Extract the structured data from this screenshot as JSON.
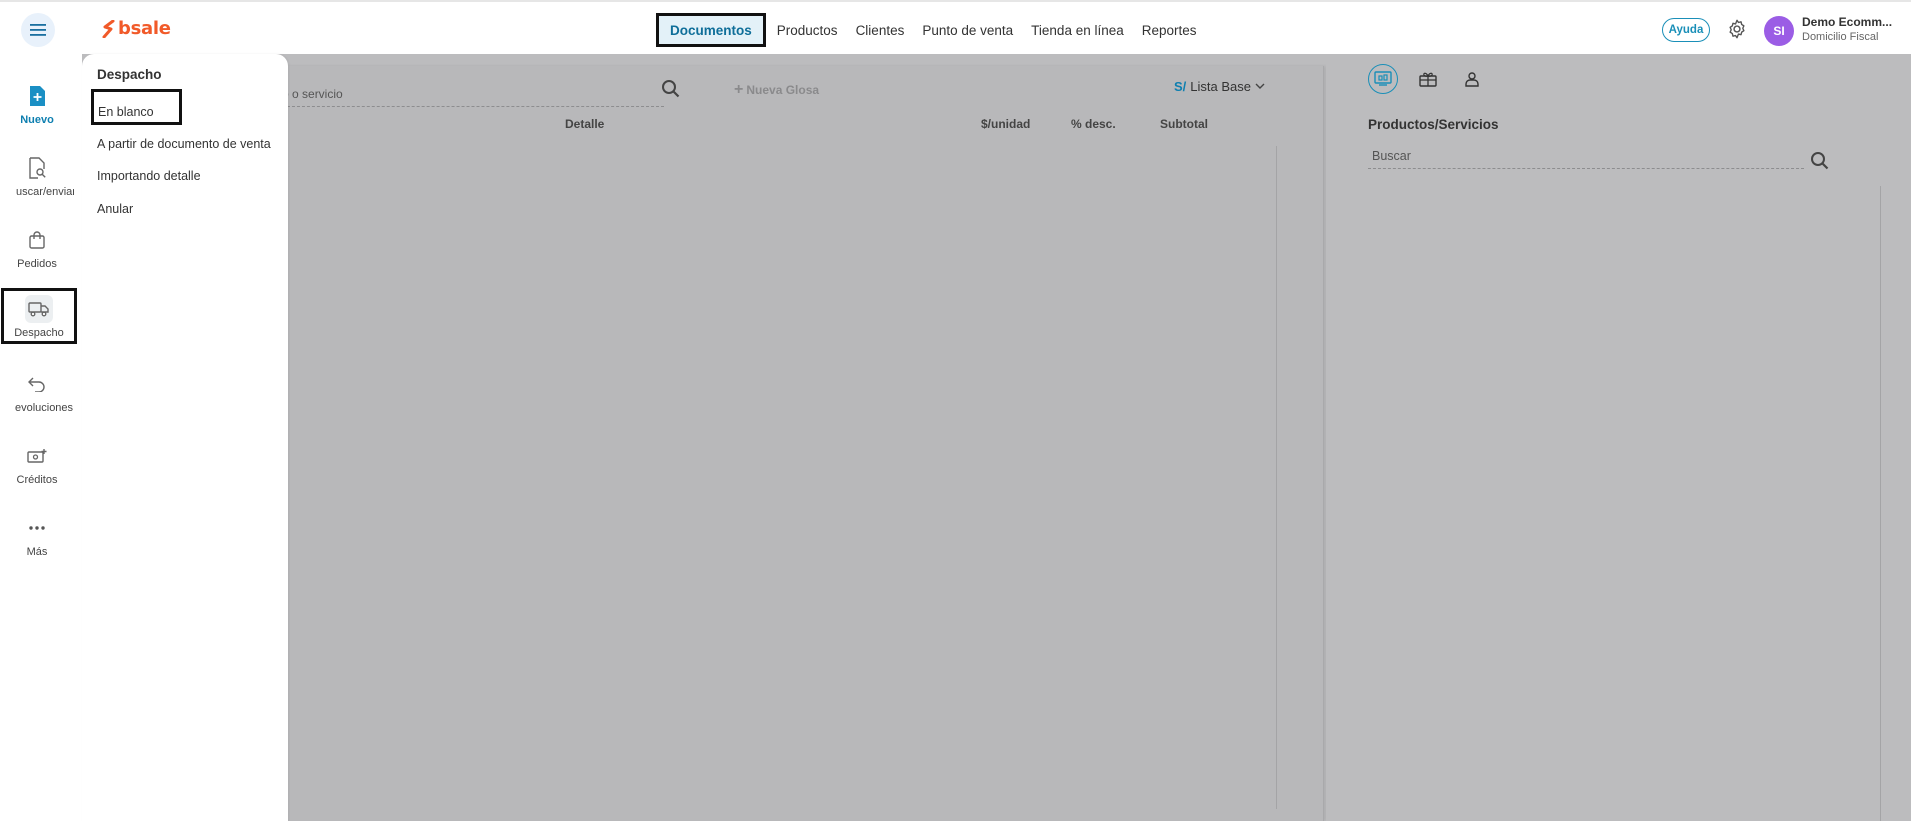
{
  "header": {
    "logo_text": "bsale",
    "nav": [
      "Documentos",
      "Productos",
      "Clientes",
      "Punto de venta",
      "Tienda en línea",
      "Reportes"
    ],
    "help_label": "Ayuda",
    "avatar_initials": "SI",
    "user_name": "Demo Ecomm...",
    "user_sub": "Domicilio Fiscal"
  },
  "sidebar": {
    "items": [
      {
        "label": "Nuevo",
        "icon": "new-document-icon"
      },
      {
        "label": "uscar/enviar",
        "icon": "search-document-icon"
      },
      {
        "label": "Pedidos",
        "icon": "bag-icon"
      },
      {
        "label": "Despacho",
        "icon": "truck-icon"
      },
      {
        "label": "evoluciones",
        "icon": "return-arrow-icon"
      },
      {
        "label": "Créditos",
        "icon": "money-plus-icon"
      },
      {
        "label": "Más",
        "icon": "more-dots-icon"
      }
    ]
  },
  "flyout": {
    "title": "Despacho",
    "items": [
      "En blanco",
      "A partir de documento de venta",
      "Importando detalle",
      "Anular"
    ]
  },
  "document": {
    "search_placeholder": "o o servicio",
    "new_glosa_label": "Nueva Glosa",
    "currency": "S/",
    "price_list": "Lista Base",
    "columns": [
      "Detalle",
      "$/unidad",
      "% desc.",
      "Subtotal"
    ]
  },
  "right_panel": {
    "title": "Productos/Servicios",
    "search_placeholder": "Buscar"
  },
  "colors": {
    "brand": "#f15a29",
    "accent": "#0e7fb0",
    "overlay": "#bcbcbe",
    "avatar": "#9b5de5"
  }
}
